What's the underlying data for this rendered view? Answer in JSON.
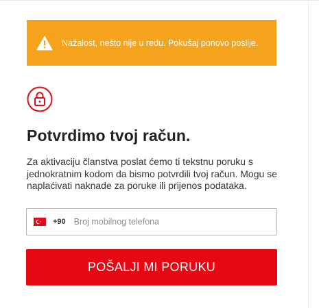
{
  "alert": {
    "message": "Nažalost, nešto nije u redu. Pokušaj ponovo poslije.",
    "background_color": "#f5a21c",
    "icon": "warning-triangle-icon"
  },
  "lock_icon": "lock-icon",
  "heading": "Potvrdimo tvoj račun.",
  "description": "Za aktivaciju članstva poslat ćemo ti tekstnu poruku s jednokratnim kodom da bismo potvrdili tvoj račun. Mogu se naplaćivati naknade za poruke ili prijenos podataka.",
  "phone": {
    "country_flag": "turkey-flag-icon",
    "country_code": "+90",
    "placeholder": "Broj mobilnog telefona",
    "value": ""
  },
  "button": {
    "label": "POŠALJI MI PORUKU",
    "color": "#e50914"
  }
}
